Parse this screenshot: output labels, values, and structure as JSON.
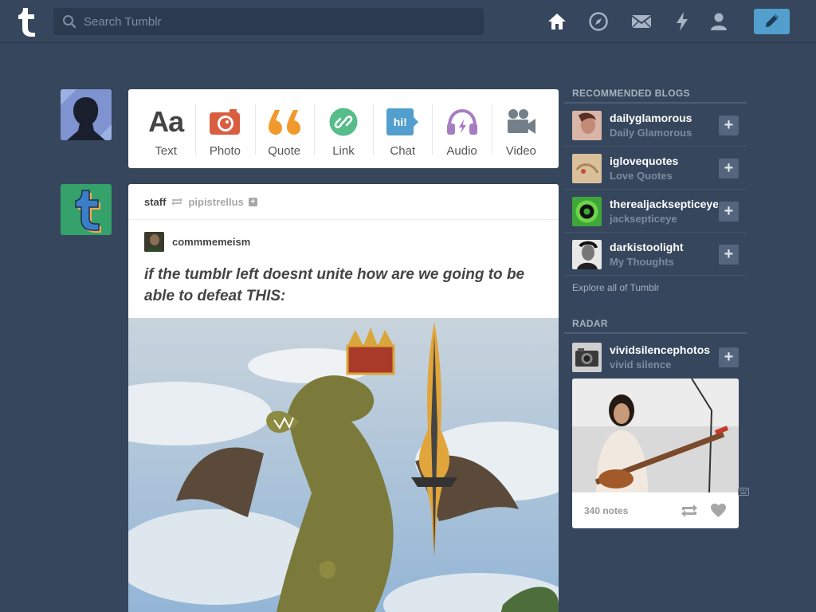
{
  "header": {
    "logo": "tumblr-t",
    "search_placeholder": "Search Tumblr",
    "nav_icons": [
      "home-icon",
      "explore-icon",
      "inbox-icon",
      "activity-icon",
      "account-icon"
    ],
    "compose_icon": "pencil-icon",
    "accent_color": "#529ecc"
  },
  "postbar": {
    "items": [
      {
        "label": "Text",
        "glyph": "Aa",
        "color": "#444444"
      },
      {
        "label": "Photo",
        "color": "#d95e40"
      },
      {
        "label": "Quote",
        "color": "#f2992e"
      },
      {
        "label": "Link",
        "color": "#56bc8a"
      },
      {
        "label": "Chat",
        "glyph": "hi!",
        "color": "#529ecc"
      },
      {
        "label": "Audio",
        "color": "#a77dc2"
      },
      {
        "label": "Video",
        "color": "#748089"
      }
    ]
  },
  "post": {
    "reblogged_by": "staff",
    "source_blog": "pipistrellus",
    "author": "commmemeism",
    "title": "if the tumblr left doesnt unite how are we going to be able to defeat THIS:"
  },
  "sidebar": {
    "recommended_title": "RECOMMENDED BLOGS",
    "blogs": [
      {
        "name": "dailyglamorous",
        "title": "Daily Glamorous"
      },
      {
        "name": "iglovequotes",
        "title": "Love Quotes"
      },
      {
        "name": "therealjacksepticeye",
        "title": "jacksepticeye"
      },
      {
        "name": "darkistoolight",
        "title": "My Thoughts"
      }
    ],
    "follow_label": "+",
    "explore_label": "Explore all of Tumblr",
    "radar_title": "RADAR",
    "radar": {
      "name": "vividsilencephotos",
      "title": "vivid silence",
      "notes": "340 notes"
    }
  }
}
